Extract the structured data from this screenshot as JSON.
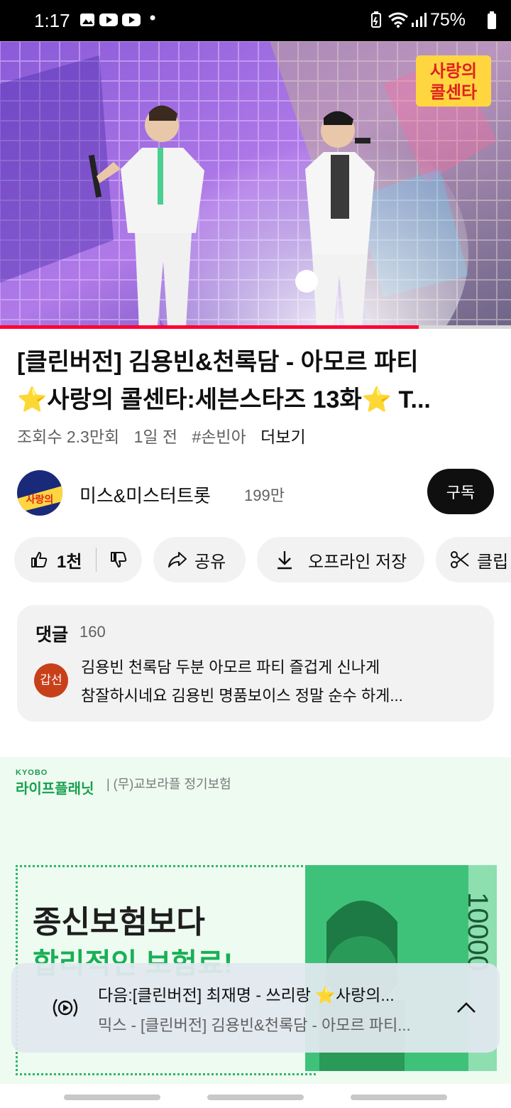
{
  "status_bar": {
    "time": "1:17",
    "dot": "•",
    "battery": "75%"
  },
  "video": {
    "overlay_logo_line1": "사랑의",
    "overlay_logo_line2": "콜센타",
    "progress": 0.82
  },
  "title": {
    "line1": "[클린버전] 김용빈&천록담 - 아모르 파티",
    "line2": "⭐사랑의 콜센타:세븐스타즈 13화⭐ T..."
  },
  "meta": {
    "views": "조회수 2.3만회",
    "age": "1일 전",
    "hashtag": "#손빈아",
    "more": "더보기"
  },
  "channel": {
    "name": "미스&미스터트롯",
    "subscribers": "199만",
    "subscribe_label": "구독",
    "avatar_text": "사랑의"
  },
  "actions": {
    "like_count": "1천",
    "share": "공유",
    "offline_save": "오프라인 저장",
    "clip": "클립"
  },
  "comments": {
    "header": "댓글",
    "count": "160",
    "top_comment": {
      "avatar_text": "갑선",
      "line1": "김용빈 천록담 두분 아모르 파티 즐겁게 신나게",
      "line2": "참잘하시네요 김용빈  명품보이스 정말 순수 하게..."
    }
  },
  "ad": {
    "brand_top": "KYOBO",
    "brand": "라이프플래닛",
    "brand_sub": "| (무)교보라플 정기보험",
    "headline1": "종신보험보다",
    "headline2": "합리적인 보험료!",
    "bill_text": "10000"
  },
  "mini_player": {
    "next_label": "다음:[클린버전] 최재명 - 쓰리랑 ⭐사랑의...",
    "current": "믹스 - [클린버전] 김용빈&천록담 - 아모르 파티..."
  }
}
